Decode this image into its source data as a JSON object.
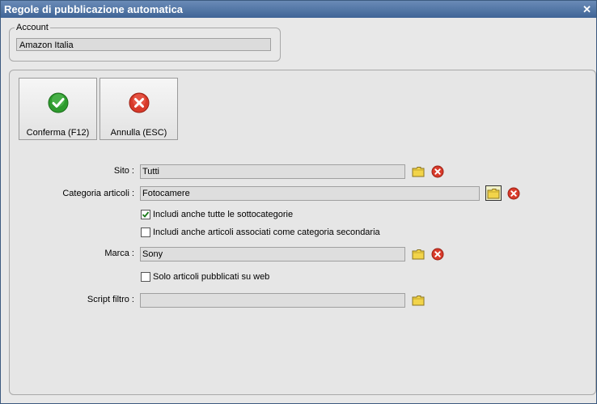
{
  "window": {
    "title": "Regole di pubblicazione automatica",
    "close_glyph": "✕"
  },
  "account": {
    "legend": "Account",
    "value": "Amazon Italia"
  },
  "toolbar": {
    "confirm_label": "Conferma (F12)",
    "cancel_label": "Annulla (ESC)"
  },
  "form": {
    "sito": {
      "label": "Sito :",
      "value": "Tutti"
    },
    "categoria": {
      "label": "Categoria articoli :",
      "value": "Fotocamere"
    },
    "include_sub": {
      "label": "Includi anche tutte le sottocategorie",
      "checked": true
    },
    "include_secondary": {
      "label": "Includi anche articoli associati come categoria secondaria",
      "checked": false
    },
    "marca": {
      "label": "Marca :",
      "value": "Sony"
    },
    "solo_web": {
      "label": "Solo articoli pubblicati su web",
      "checked": false
    },
    "script": {
      "label": "Script filtro :",
      "value": ""
    }
  },
  "icons": {
    "confirm": "check-icon",
    "cancel": "cross-icon",
    "browse": "folder-icon",
    "clear": "clear-icon"
  },
  "colors": {
    "titlebar": "#4a6fa5",
    "confirm": "#2e9b2e",
    "cancel": "#d83a2a"
  }
}
